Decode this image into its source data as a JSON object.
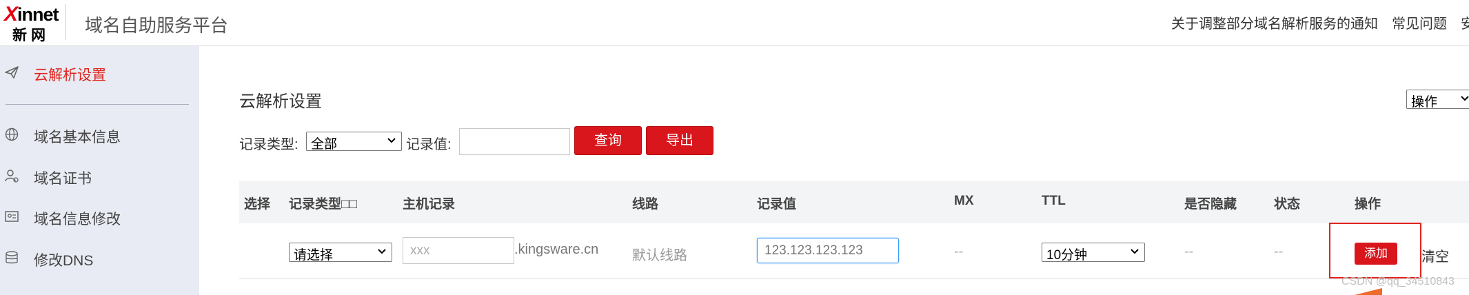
{
  "header": {
    "logo_en": "innet",
    "logo_x": "X",
    "logo_cn": "新网",
    "title": "域名自助服务平台",
    "nav": [
      "关于调整部分域名解析服务的通知",
      "常见问题",
      "安"
    ]
  },
  "sidebar": {
    "items": [
      {
        "label": "云解析设置",
        "icon": "paper-plane-icon",
        "active": true
      },
      {
        "label": "域名基本信息",
        "icon": "globe-icon"
      },
      {
        "label": "域名证书",
        "icon": "user-certificate-icon"
      },
      {
        "label": "域名信息修改",
        "icon": "id-card-icon"
      },
      {
        "label": "修改DNS",
        "icon": "dns-server-icon"
      }
    ]
  },
  "main": {
    "title": "云解析设置",
    "ops_select": "操作",
    "filter": {
      "type_label": "记录类型:",
      "type_value": "全部",
      "value_label": "记录值:",
      "value_input": "",
      "query_button": "查询",
      "export_button": "导出"
    },
    "table": {
      "headers": [
        "选择",
        "记录类型□□",
        "主机记录",
        "线路",
        "记录值",
        "MX",
        "TTL",
        "是否隐藏",
        "状态",
        "操作"
      ],
      "new_row": {
        "type_select": "请选择",
        "host_placeholder": "xxx",
        "domain_suffix": ".kingsware.cn",
        "line": "默认线路",
        "value": "123.123.123.123",
        "mx": "--",
        "ttl_select": "10分钟",
        "hidden": "--",
        "status": "--",
        "add_button": "添加",
        "clear_link": "清空"
      }
    }
  },
  "watermark": "CSDN @qq_34510843",
  "colors": {
    "accent": "#d9161c",
    "sidebar_bg": "#e8ebf3",
    "active_text": "#e0241c",
    "table_header_bg": "#f3f4f6"
  }
}
